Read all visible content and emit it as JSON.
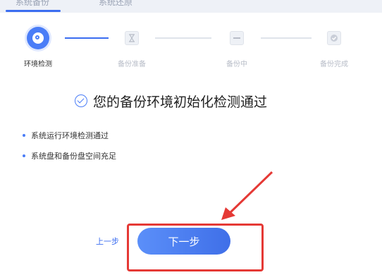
{
  "tabs": [
    {
      "label": "系统备份"
    },
    {
      "label": "系统还原"
    }
  ],
  "steps": [
    {
      "label": "环境检测",
      "state": "active"
    },
    {
      "label": "备份准备",
      "state": "pending"
    },
    {
      "label": "备份中",
      "state": "pending"
    },
    {
      "label": "备份完成",
      "state": "pending"
    }
  ],
  "result": {
    "title": "您的备份环境初始化检测通过",
    "items": [
      "系统运行环境检测通过",
      "系统盘和备份盘空间充足"
    ]
  },
  "actions": {
    "prev_label": "上一步",
    "next_label": "下一步"
  },
  "colors": {
    "accent": "#4a7df7",
    "annotation": "#e53935"
  }
}
